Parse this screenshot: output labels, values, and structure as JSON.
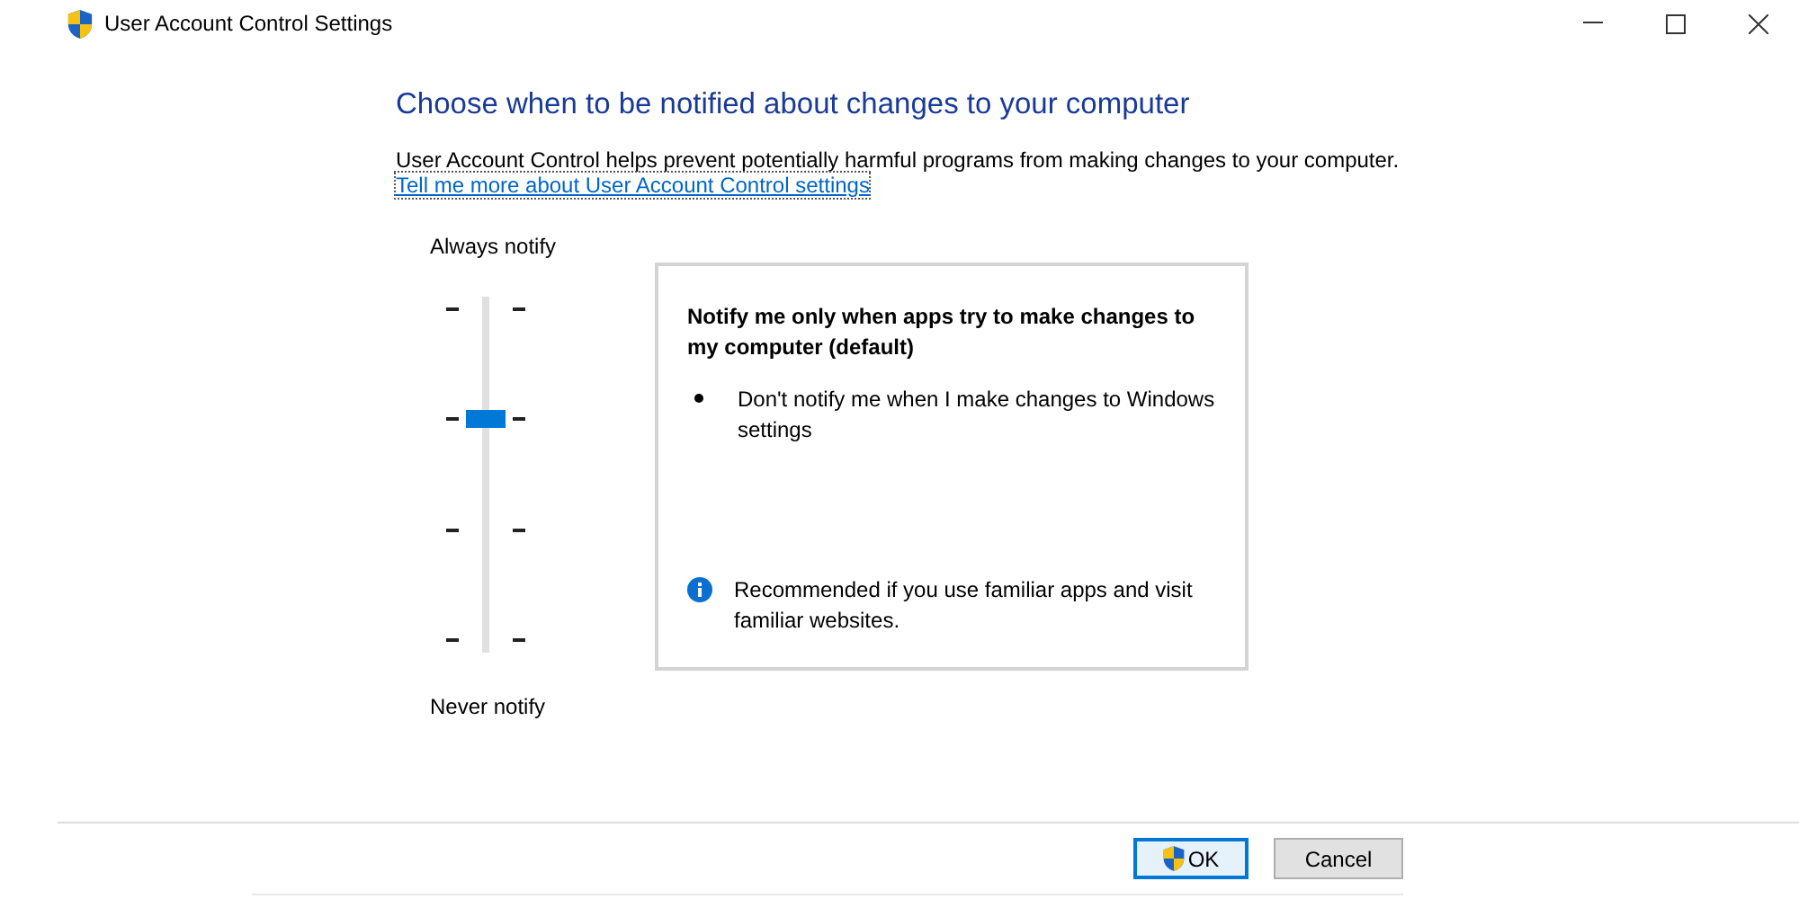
{
  "window": {
    "title": "User Account Control Settings"
  },
  "heading": "Choose when to be notified about changes to your computer",
  "description": "User Account Control helps prevent potentially harmful programs from making changes to your computer.",
  "link": "Tell me more about User Account Control settings",
  "slider": {
    "top_label": "Always notify",
    "bottom_label": "Never notify",
    "level": 0.667
  },
  "panel": {
    "title": "Notify me only when apps try to make changes to my computer (default)",
    "bullets": [
      "Don't notify me when I make changes to Windows settings"
    ],
    "note": "Recommended if you use familiar apps and visit familiar websites."
  },
  "buttons": [
    {
      "label": "OK",
      "shield": true,
      "default": true
    },
    {
      "label": "Cancel",
      "shield": false,
      "default": false
    }
  ]
}
